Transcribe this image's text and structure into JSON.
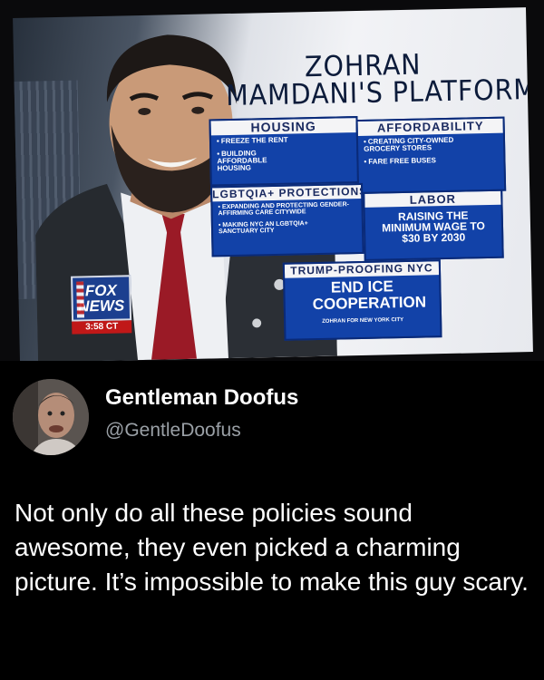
{
  "tv_graphic": {
    "headline_line1": "ZOHRAN",
    "headline_line2": "MAMDANI'S PLATFORM",
    "housing": {
      "title": "HOUSING",
      "items": [
        "FREEZE THE RENT",
        "BUILDING AFFORDABLE HOUSING"
      ]
    },
    "affordability": {
      "title": "AFFORDABILITY",
      "items": [
        "CREATING CITY-OWNED GROCERY STORES",
        "FARE FREE BUSES"
      ]
    },
    "lgbtqia": {
      "title": "LGBTQIA+ PROTECTIONS",
      "items": [
        "EXPANDING AND PROTECTING GENDER-AFFIRMING CARE CITYWIDE",
        "MAKING NYC AN LGBTQIA+ SANCTUARY CITY"
      ]
    },
    "labor": {
      "title": "LABOR",
      "body": "RAISING THE MINIMUM WAGE TO $30 BY 2030"
    },
    "trump": {
      "title": "TRUMP-PROOFING NYC",
      "body": "END ICE COOPERATION",
      "footer": "ZOHRAN FOR NEW YORK CITY"
    },
    "logo_line1": "FOX",
    "logo_line2": "NEWS",
    "clock": "3:58 CT"
  },
  "tweet": {
    "display_name": "Gentleman Doofus",
    "handle": "@GentleDoofus",
    "text": "Not only do all these policies sound awesome, they even picked a charming picture. It’s impossible to make this guy scary."
  }
}
